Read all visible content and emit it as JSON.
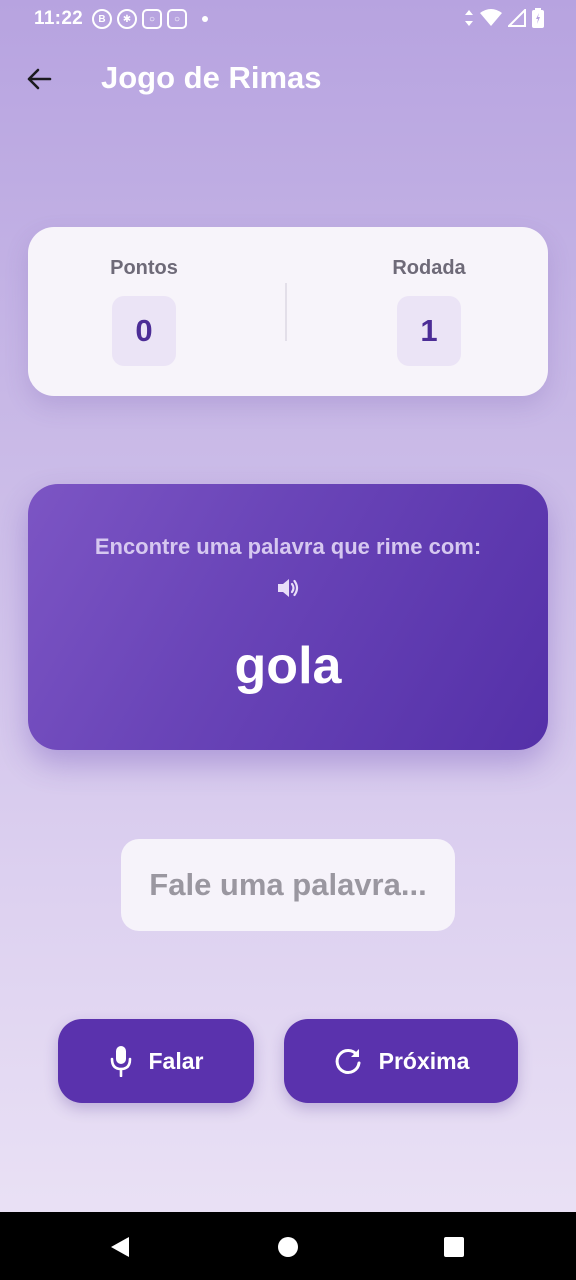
{
  "status_bar": {
    "time": "11:22",
    "left_icons": [
      "b-circle-icon",
      "settings-badge-icon",
      "instagram-icon",
      "instagram-icon",
      "dot-icon"
    ],
    "right_icons": [
      "data-arrows-icon",
      "wifi-icon",
      "signal-icon",
      "battery-icon"
    ]
  },
  "header": {
    "title": "Jogo de Rimas",
    "back_icon": "arrow-left-icon"
  },
  "score": {
    "points_label": "Pontos",
    "points_value": "0",
    "round_label": "Rodada",
    "round_value": "1"
  },
  "challenge": {
    "prompt": "Encontre uma palavra que rime com:",
    "speaker_icon": "volume-icon",
    "word": "gola"
  },
  "answer": {
    "placeholder": "Fale uma palavra..."
  },
  "actions": {
    "speak_label": "Falar",
    "speak_icon": "mic-icon",
    "next_label": "Próxima",
    "next_icon": "refresh-icon"
  },
  "colors": {
    "primary": "#5a32ad",
    "card_gradient_start": "#7c55c4",
    "card_gradient_end": "#5430a8",
    "score_value": "#4c2d96"
  }
}
